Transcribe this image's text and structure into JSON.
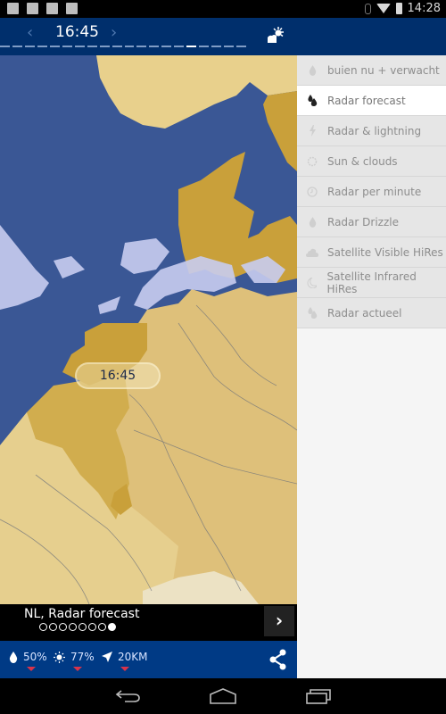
{
  "status_bar": {
    "notification_icons": [
      "chat-icon",
      "image-icon",
      "clipboard-check-icon",
      "play-store-icon"
    ],
    "system_icons": [
      "bluetooth-icon",
      "wifi-icon",
      "battery-icon"
    ],
    "clock": "14:28"
  },
  "header": {
    "prev_label": "‹",
    "time": "16:45",
    "next_label": "›",
    "timeline_segments": 20,
    "timeline_active_index": 15,
    "weather_icon": "sun-cloud-icon"
  },
  "map": {
    "time_label": "16:45",
    "colors": {
      "sea": "#3a5795",
      "land_light": "#e8d08c",
      "land_mid": "#d8ba68",
      "land_dark": "#c9a03a",
      "rain": "#c8cdf0"
    }
  },
  "caption": {
    "title": "NL, Radar forecast",
    "page_count": 8,
    "active_page": 8,
    "next_button": "›"
  },
  "stats": [
    {
      "icon": "droplet-icon",
      "value": "50%"
    },
    {
      "icon": "sun-icon",
      "value": "77%"
    },
    {
      "icon": "location-arrow-icon",
      "value": "20KM"
    }
  ],
  "share_icon": "share-icon",
  "menu": {
    "items": [
      {
        "label": "buien nu + verwacht",
        "icon": "droplet-icon",
        "active": false
      },
      {
        "label": "Radar forecast",
        "icon": "droplets-icon",
        "active": true
      },
      {
        "label": "Radar & lightning",
        "icon": "lightning-icon",
        "active": false
      },
      {
        "label": "Sun & clouds",
        "icon": "sun-outline-icon",
        "active": false
      },
      {
        "label": "Radar per minute",
        "icon": "clock-icon",
        "active": false
      },
      {
        "label": "Radar Drizzle",
        "icon": "droplet-icon",
        "active": false
      },
      {
        "label": "Satellite Visible HiRes",
        "icon": "cloud-icon",
        "active": false
      },
      {
        "label": "Satellite Infrared HiRes",
        "icon": "moon-icon",
        "active": false
      },
      {
        "label": "Radar actueel",
        "icon": "droplets-icon",
        "active": false
      }
    ]
  },
  "nav_bar": {
    "buttons": [
      "back-icon",
      "home-icon",
      "recents-icon"
    ]
  },
  "colors": {
    "header_bg": "#002f6c",
    "bottom_bar_bg": "#003a85",
    "marker_red": "#d9334a",
    "menu_bg": "#e6e6e6",
    "menu_active_bg": "#ffffff"
  }
}
